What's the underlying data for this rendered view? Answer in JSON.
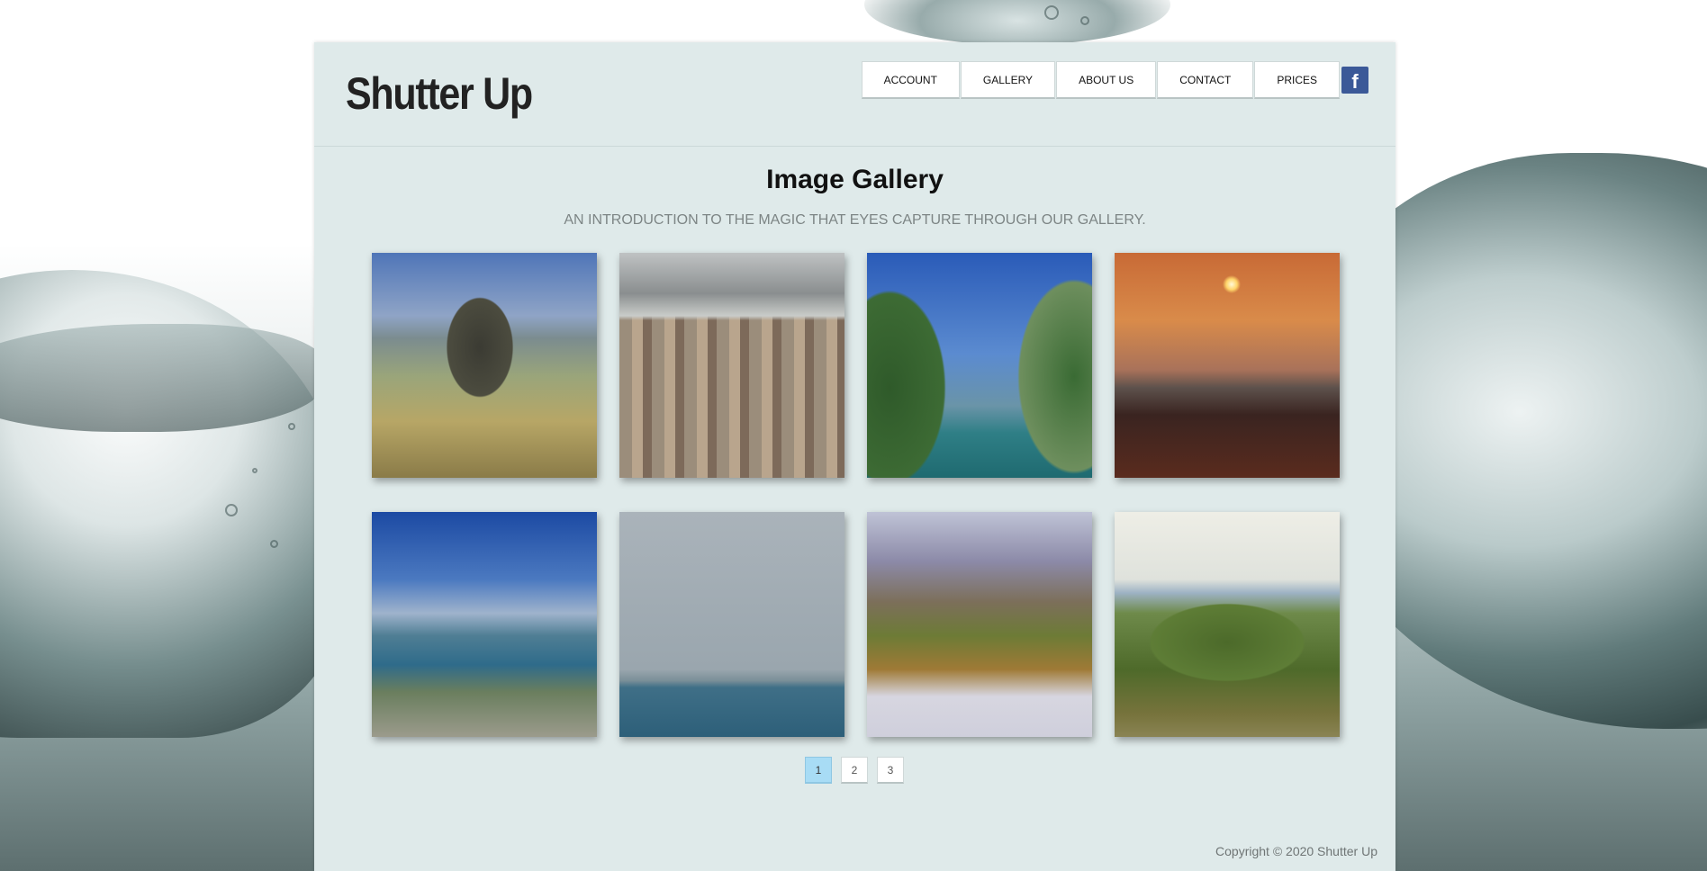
{
  "header": {
    "logo": "Shutter Up",
    "nav": [
      "ACCOUNT",
      "GALLERY",
      "ABOUT US",
      "CONTACT",
      "PRICES"
    ],
    "social_icon": "facebook-icon"
  },
  "main": {
    "title": "Image Gallery",
    "subtitle": "AN INTRODUCTION TO THE MAGIC THAT EYES CAPTURE THROUGH OUR GALLERY."
  },
  "gallery": {
    "images": [
      "mountain-peak-photo",
      "city-street-photo",
      "river-canyon-photo",
      "sunset-sea-photo",
      "aerial-river-town-photo",
      "sea-ships-photo",
      "autumn-mountain-trail-photo",
      "coastal-pine-trees-photo"
    ]
  },
  "pagination": {
    "pages": [
      "1",
      "2",
      "3"
    ],
    "current": "1"
  },
  "footer": {
    "copyright": "Copyright © 2020 Shutter Up"
  },
  "colors": {
    "panel": "#dfeaea",
    "facebook": "#3b5998",
    "active_page": "#a8dcf5"
  }
}
